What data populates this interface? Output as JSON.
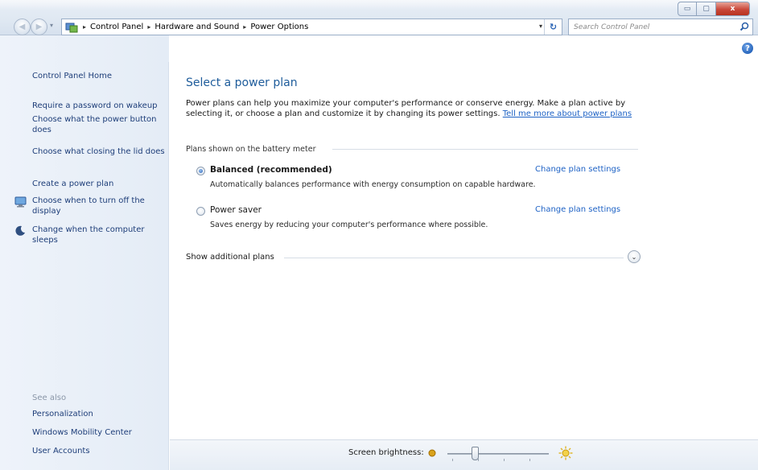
{
  "window": {
    "controls": {
      "minimize": "▭",
      "maximize": "▢",
      "close": "x"
    }
  },
  "navigation": {
    "back_glyph": "◀",
    "forward_glyph": "▶",
    "recent_glyph": "▾",
    "breadcrumbs": [
      "Control Panel",
      "Hardware and Sound",
      "Power Options"
    ],
    "breadcrumb_separator": "▸",
    "address_dropdown_glyph": "▾",
    "refresh_glyph": "↻",
    "search_placeholder": "Search Control Panel"
  },
  "sidebar": {
    "home": "Control Panel Home",
    "tasks": [
      {
        "label": "Require a password on wakeup",
        "icon": null
      },
      {
        "label": "Choose what the power button does",
        "icon": null
      },
      {
        "label": "Choose what closing the lid does",
        "icon": null
      },
      {
        "label": "Create a power plan",
        "icon": null
      },
      {
        "label": "Choose when to turn off the display",
        "icon": "monitor-icon"
      },
      {
        "label": "Change when the computer sleeps",
        "icon": "moon-icon"
      }
    ],
    "see_also_title": "See also",
    "see_also": [
      "Personalization",
      "Windows Mobility Center",
      "User Accounts"
    ]
  },
  "main": {
    "help_glyph": "?",
    "title": "Select a power plan",
    "intro_text": "Power plans can help you maximize your computer's performance or conserve energy. Make a plan active by selecting it, or choose a plan and customize it by changing its power settings.",
    "intro_link": "Tell me more about power plans",
    "group_label": "Plans shown on the battery meter",
    "plans": [
      {
        "name": "Balanced (recommended)",
        "selected": true,
        "description": "Automatically balances performance with energy consumption on capable hardware.",
        "link": "Change plan settings"
      },
      {
        "name": "Power saver",
        "selected": false,
        "description": "Saves energy by reducing your computer's performance where possible.",
        "link": "Change plan settings"
      }
    ],
    "show_more": "Show additional plans",
    "expand_glyph": "⌄"
  },
  "brightness": {
    "label": "Screen brightness:",
    "level_fraction": 0.27
  },
  "colors": {
    "link": "#1e62c5",
    "title": "#1e5c9b",
    "sidebar_bg": "#e9f0f8"
  }
}
